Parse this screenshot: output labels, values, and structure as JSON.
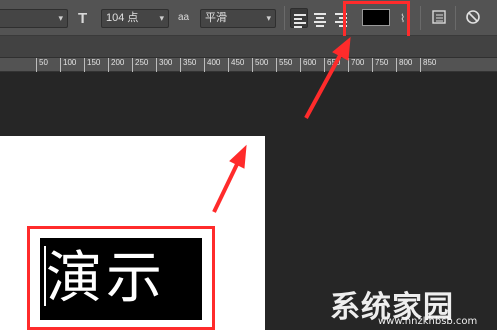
{
  "options_bar": {
    "size_value": "104 点",
    "antialias_icon_text": "aa",
    "antialias_value": "平滑",
    "text_color_hex": "#000000",
    "font_size_icon": "T"
  },
  "ruler": {
    "ticks": [
      "50",
      "100",
      "150",
      "200",
      "250",
      "300",
      "350",
      "400",
      "450",
      "500",
      "550",
      "600",
      "650",
      "700",
      "750",
      "800",
      "850"
    ]
  },
  "canvas": {
    "text": "演示"
  },
  "watermark": {
    "brand": "系统家园",
    "url": "www.hnzkhbsb.com"
  },
  "colors": {
    "annotation_red": "#ff2b2b",
    "panel_bg": "#535353",
    "workspace_bg": "#262626"
  }
}
